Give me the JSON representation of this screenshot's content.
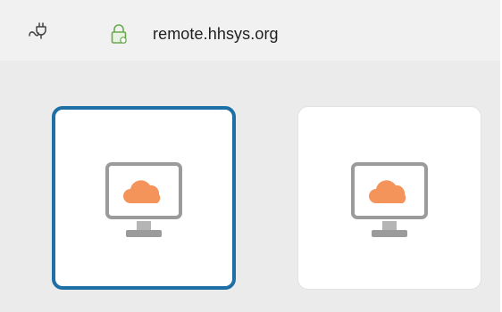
{
  "address_bar": {
    "connection_icon": "plug-icon",
    "security_icon": "lock-icon",
    "host": "remote.hhsys.org"
  },
  "tiles": [
    {
      "icon": "cloud-pc-icon",
      "state": "selected"
    },
    {
      "icon": "cloud-pc-icon",
      "state": "normal"
    }
  ],
  "colors": {
    "selected_border": "#1f6fa7",
    "cloud": "#f4935a",
    "lock": "#6aa84f",
    "monitor_frame": "#9b9b9b"
  }
}
